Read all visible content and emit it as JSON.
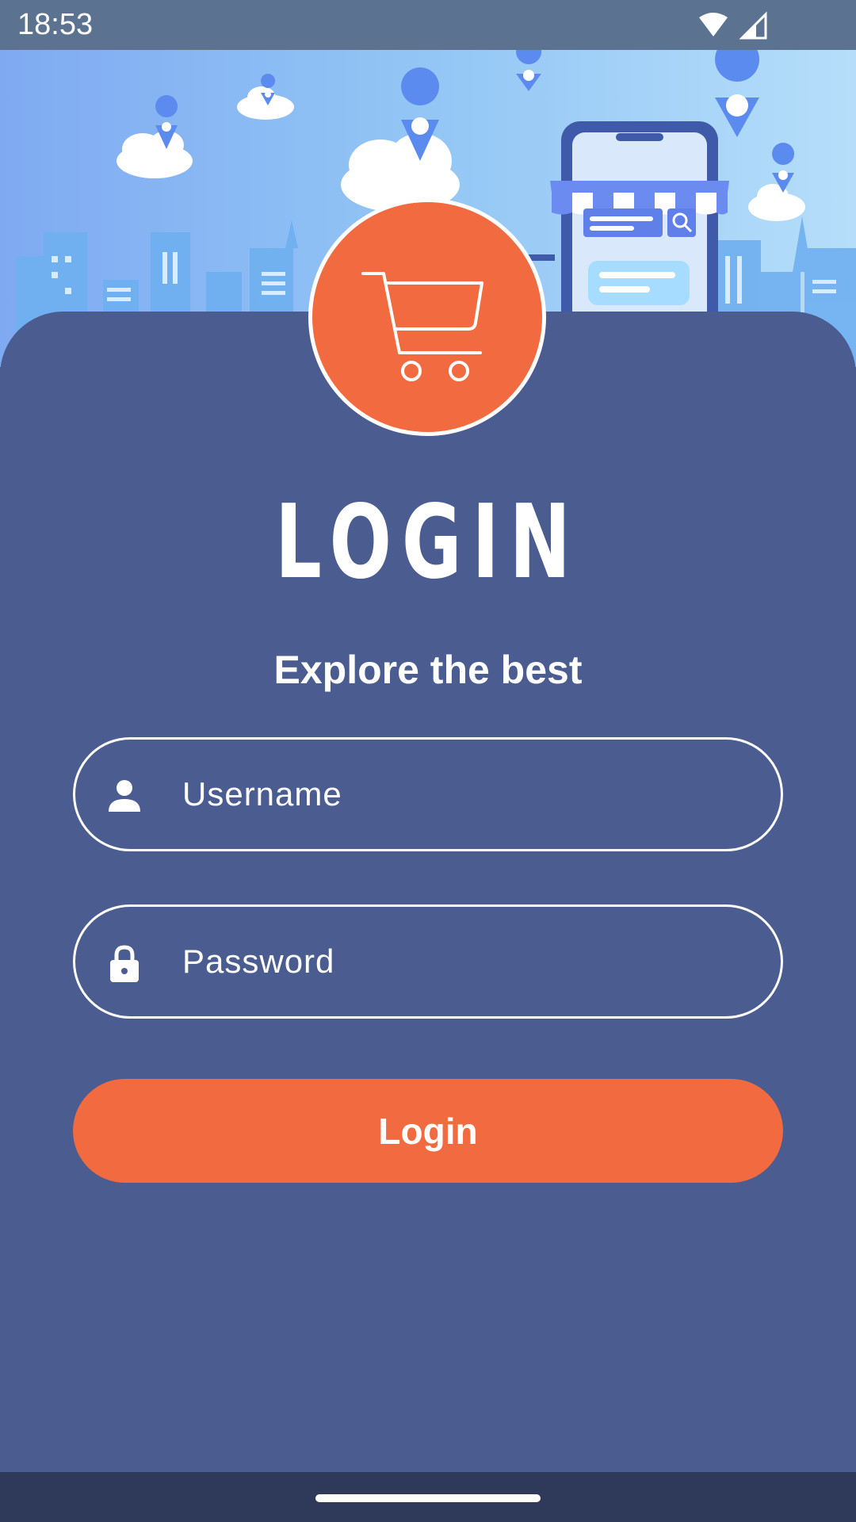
{
  "status_bar": {
    "time": "18:53"
  },
  "hero": {
    "illustration": "online-store-city-illustration"
  },
  "logo": {
    "icon": "shopping-cart-icon"
  },
  "header": {
    "title": "LOGIN",
    "subtitle": "Explore the best"
  },
  "form": {
    "username": {
      "placeholder": "Username",
      "value": "",
      "icon": "person-icon"
    },
    "password": {
      "placeholder": "Password",
      "value": "",
      "icon": "lock-icon"
    },
    "submit_label": "Login"
  },
  "colors": {
    "background": "#4a5c90",
    "accent": "#f26a3f",
    "status_bar": "#5b7290",
    "nav_bar": "#2f3a5a",
    "sky": "#8ec1f5"
  }
}
